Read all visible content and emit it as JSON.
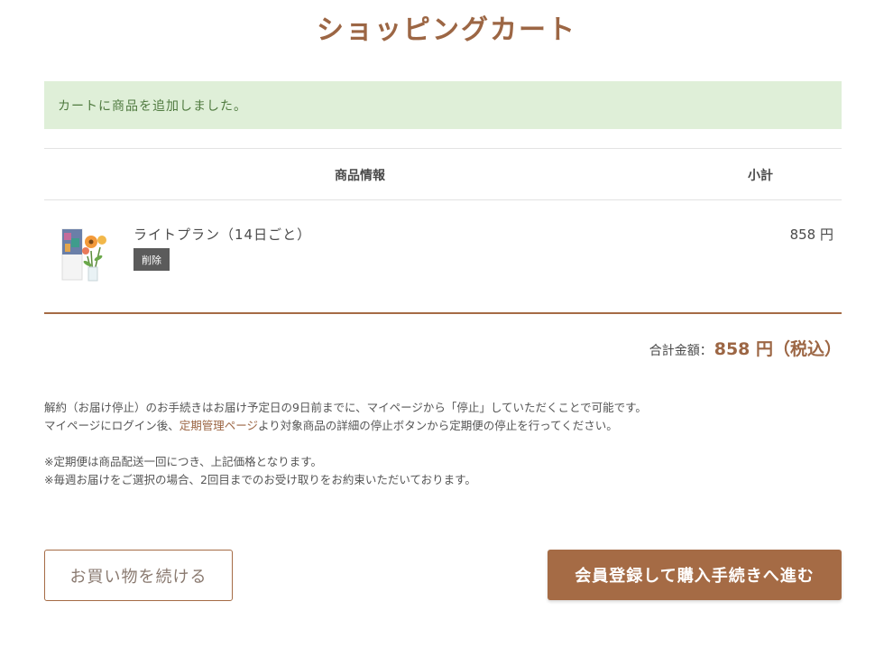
{
  "page": {
    "title": "ショッピングカート"
  },
  "notice": {
    "message": "カートに商品を追加しました。"
  },
  "table": {
    "headers": {
      "info": "商品情報",
      "subtotal": "小計"
    },
    "items": [
      {
        "name": "ライトプラン（14日ごと）",
        "delete_label": "削除",
        "price": "858 円"
      }
    ]
  },
  "total": {
    "label": "合計金額：",
    "value": "858 円（税込）"
  },
  "notes": {
    "line1": "解約（お届け停止）のお手続きはお届け予定日の9日前までに、マイページから「停止」していただくことで可能です。",
    "line2_prefix": "マイページにログイン後、",
    "line2_link": "定期管理ページ",
    "line2_suffix": "より対象商品の詳細の停止ボタンから定期便の停止を行ってください。",
    "line3": "※定期便は商品配送一回につき、上記価格となります。",
    "line4": "※毎週お届けをご選択の場合、2回目までのお受け取りをお約束いただいております。"
  },
  "buttons": {
    "continue_shopping": "お買い物を続ける",
    "register_checkout": "会員登録して購入手続きへ進む"
  },
  "colors": {
    "accent": "#a56b45",
    "notice_bg": "#dfefd8",
    "notice_text": "#4f7a3f"
  }
}
